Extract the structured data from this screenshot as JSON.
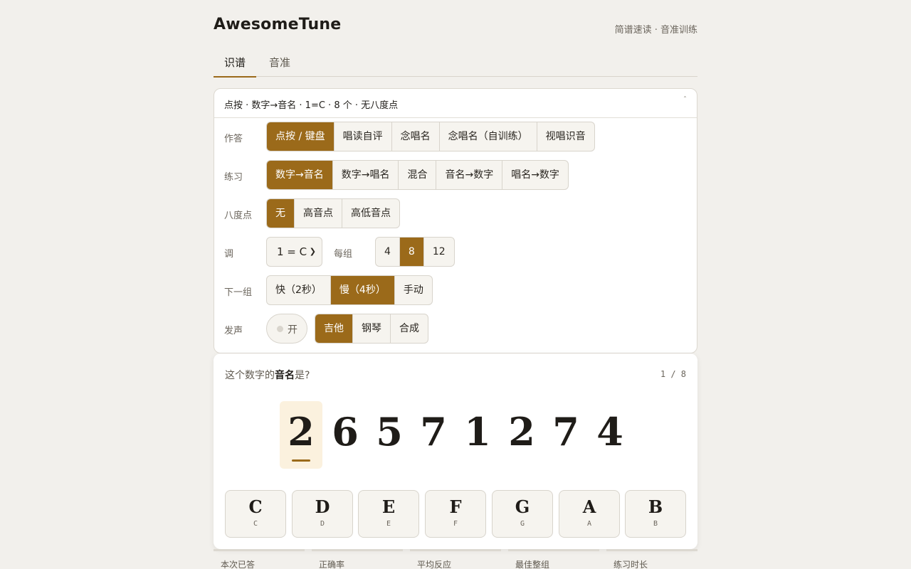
{
  "app": {
    "title": "AwesomeTune",
    "subtitle": "简谱速读 · 音准训练"
  },
  "tabs": [
    {
      "label": "识谱",
      "active": true
    },
    {
      "label": "音准",
      "active": false
    }
  ],
  "settings": {
    "summary": "点按 · 数字→音名 · 1=C · 8 个 · 无八度点",
    "chevron_icon": "chevron-up-icon",
    "answer": {
      "label": "作答",
      "options": [
        "点按 / 键盘",
        "唱读自评",
        "念唱名",
        "念唱名（自训练）",
        "视唱识音"
      ],
      "selected": 0
    },
    "practice": {
      "label": "练习",
      "options": [
        "数字→音名",
        "数字→唱名",
        "混合",
        "音名→数字",
        "唱名→数字"
      ],
      "selected": 0
    },
    "octave": {
      "label": "八度点",
      "options": [
        "无",
        "高音点",
        "高低音点"
      ],
      "selected": 0
    },
    "key": {
      "label": "调",
      "value": "1 = C",
      "arrow_icon": "chevron-down-icon"
    },
    "group": {
      "label": "每组",
      "options": [
        "4",
        "8",
        "12"
      ],
      "selected": 1
    },
    "next": {
      "label": "下一组",
      "options": [
        "快（2秒）",
        "慢（4秒）",
        "手动"
      ],
      "selected": 1
    },
    "sound": {
      "label": "发声",
      "toggle_label": "开",
      "toggle_on": false,
      "options": [
        "吉他",
        "钢琴",
        "合成"
      ],
      "selected": 0
    }
  },
  "quiz": {
    "question_prefix": "这个数字的",
    "question_bold": "音名",
    "question_suffix": "是?",
    "progress": "1 / 8",
    "digits": [
      "2",
      "6",
      "5",
      "7",
      "1",
      "2",
      "7",
      "4"
    ],
    "current_index": 0,
    "keys": [
      {
        "note": "C",
        "sub": "C"
      },
      {
        "note": "D",
        "sub": "D"
      },
      {
        "note": "E",
        "sub": "E"
      },
      {
        "note": "F",
        "sub": "F"
      },
      {
        "note": "G",
        "sub": "G"
      },
      {
        "note": "A",
        "sub": "A"
      },
      {
        "note": "B",
        "sub": "B"
      }
    ]
  },
  "stats": [
    "本次已答",
    "正确率",
    "平均反应",
    "最佳整组",
    "练习时长"
  ],
  "colors": {
    "accent": "#9b6a1a",
    "background": "#f2f0ec",
    "highlight": "#fbf1de"
  }
}
